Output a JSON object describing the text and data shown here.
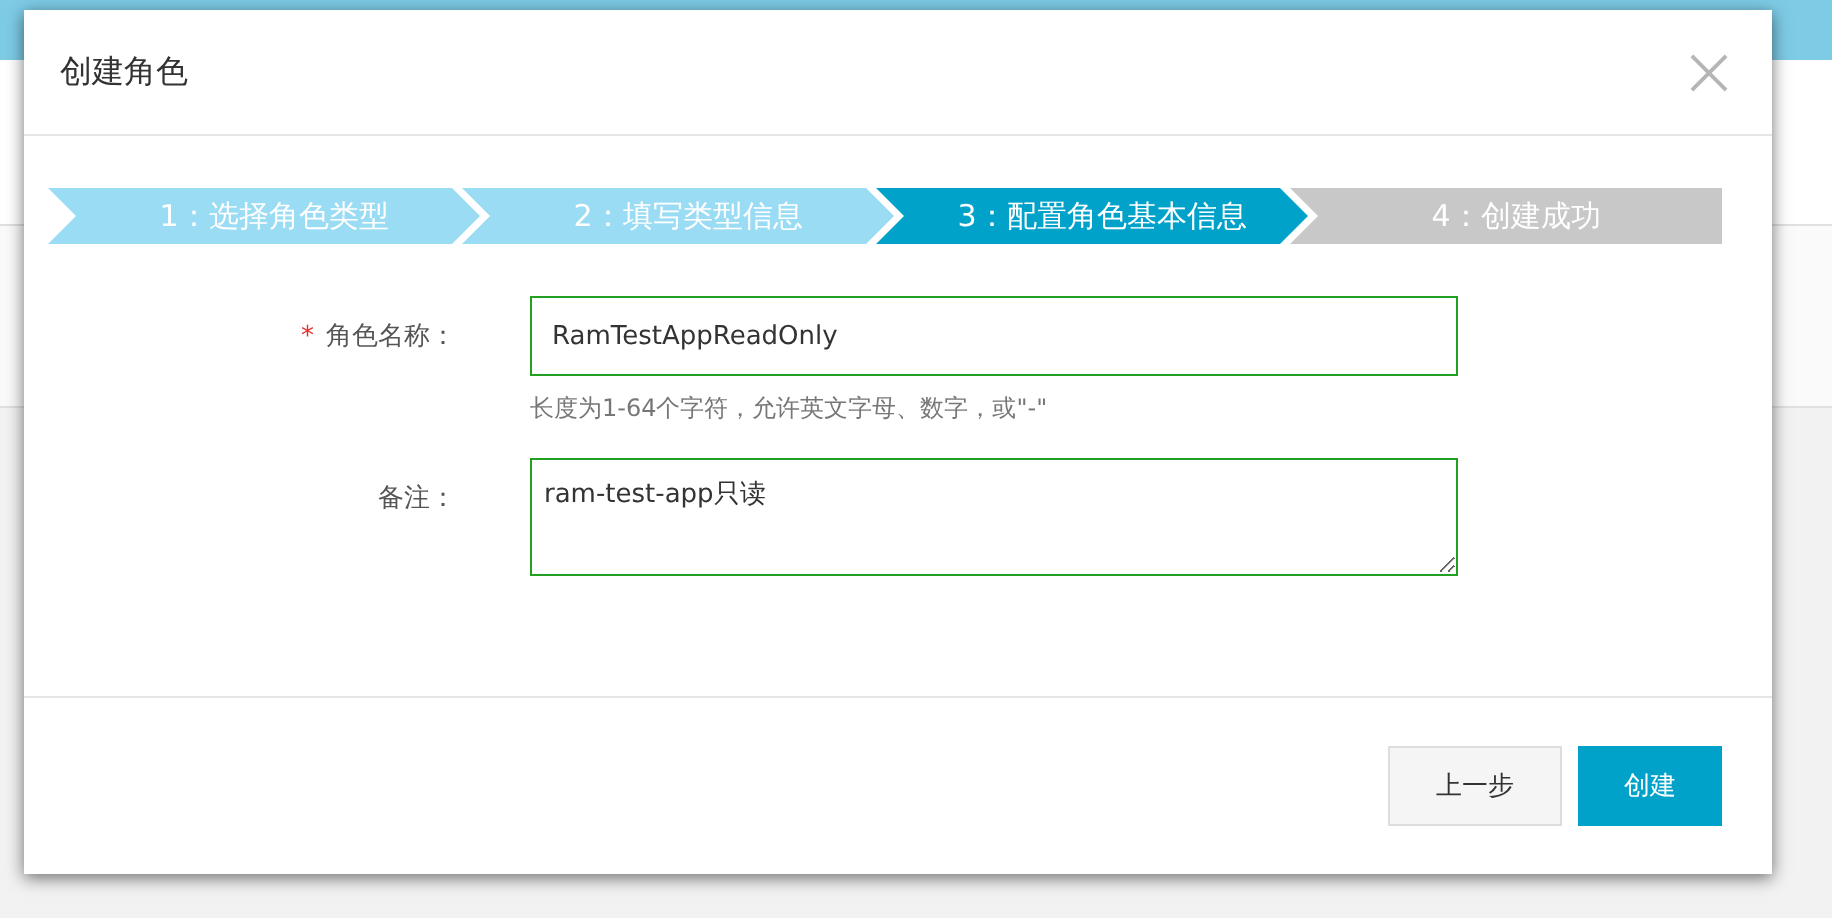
{
  "dialog": {
    "title": "创建角色"
  },
  "steps": [
    {
      "label": "1：选择角色类型",
      "completed": true,
      "selected": false
    },
    {
      "label": "2：填写类型信息",
      "completed": true,
      "selected": false
    },
    {
      "label": "3：配置角色基本信息",
      "completed": false,
      "selected": true
    },
    {
      "label": "4：创建成功",
      "completed": false,
      "selected": false
    }
  ],
  "fields": [
    {
      "kind": "input",
      "label": "角色名称：",
      "required_mark": "*",
      "value": "RamTestAppReadOnly",
      "hint": "长度为1-64个字符，允许英文字母、数字，或\"-\""
    },
    {
      "kind": "textarea",
      "label": "备注：",
      "value": "ram-test-app只读"
    }
  ],
  "buttons": [
    {
      "label": "上一步",
      "kind": "secondary"
    },
    {
      "label": "创建",
      "kind": "primary"
    }
  ]
}
